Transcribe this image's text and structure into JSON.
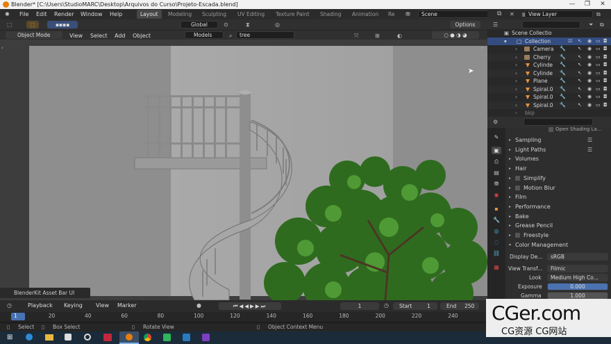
{
  "window": {
    "title": "Blender* [C:\\Users\\StudioMARC\\Desktop\\Arquivos do Curso\\Projeto-Escada.blend]",
    "minimize": "—",
    "maximize": "❐",
    "close": "✕"
  },
  "menu": [
    "File",
    "Edit",
    "Render",
    "Window",
    "Help"
  ],
  "workspaces": [
    "Layout",
    "Modeling",
    "Sculpting",
    "UV Editing",
    "Texture Paint",
    "Shading",
    "Animation",
    "Re"
  ],
  "scene": {
    "label": "Scene",
    "view_layer": "View Layer"
  },
  "header": {
    "orientation": "Global",
    "options": "Options"
  },
  "viewport_header": {
    "mode": "Object Mode",
    "menus": [
      "View",
      "Select",
      "Add",
      "Object"
    ],
    "models_dropdown": "Models",
    "search_value": "tree"
  },
  "blenderkit_panel": "BlenderKit Asset Bar UI",
  "timeline": {
    "menus": [
      "Playback",
      "Keying",
      "View",
      "Marker"
    ],
    "current_frame": "1",
    "start_label": "Start",
    "start": "1",
    "end_label": "End",
    "end": "250",
    "ruler": [
      "1",
      "20",
      "40",
      "60",
      "80",
      "100",
      "120",
      "140",
      "160",
      "180",
      "200",
      "220",
      "240"
    ]
  },
  "statusbar": {
    "select": "Select",
    "box_select": "Box Select",
    "rotate_view": "Rotate View",
    "context_menu": "Object Context Menu"
  },
  "outliner": {
    "root": "Scene Collectio",
    "collection": "Collection",
    "items": [
      "Camera",
      "Cherry",
      "Cylinde",
      "Cylinde",
      "Plane",
      "Spiral.0",
      "Spiral.0",
      "Spiral.0"
    ],
    "bkp": "bkp"
  },
  "properties": {
    "partial_top": "Open Shading La...",
    "sections": [
      "Sampling",
      "Light Paths",
      "Volumes",
      "Hair",
      "Simplify",
      "Motion Blur",
      "Film",
      "Performance",
      "Bake",
      "Grease Pencil",
      "Freestyle",
      "Color Management"
    ],
    "display_device_label": "Display De...",
    "display_device": "sRGB",
    "view_transform_label": "View Transf...",
    "view_transform": "Filmic",
    "look_label": "Look",
    "look": "Medium High Co...",
    "exposure_label": "Exposure",
    "exposure": "0.000",
    "gamma_label": "Gamma",
    "gamma": "1.000"
  },
  "watermark": {
    "main": "CGer.com",
    "sub": "CG资源  CG网站"
  },
  "colors": {
    "accent": "#334d80",
    "selected_tab": "#474747",
    "warning": "#e87d0d"
  }
}
